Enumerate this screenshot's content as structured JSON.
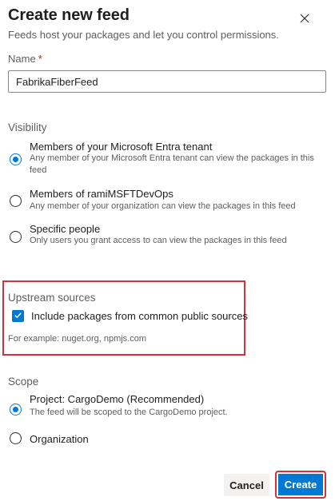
{
  "dialog": {
    "title": "Create new feed",
    "subtitle": "Feeds host your packages and let you control permissions.",
    "close_icon": "close-icon"
  },
  "name_field": {
    "label": "Name",
    "required_marker": "*",
    "value": "FabrikaFiberFeed"
  },
  "visibility": {
    "title": "Visibility",
    "options": [
      {
        "label": "Members of your Microsoft Entra tenant",
        "description_line1": "Any member of your Microsoft Entra tenant can view the packages in this",
        "description_line2": "feed",
        "selected": true
      },
      {
        "label": "Members of ramiMSFTDevOps",
        "description_line1": "Any member of your organization can view the packages in this feed",
        "selected": false
      },
      {
        "label": "Specific people",
        "description_line1": "Only users you grant access to can view the packages in this feed",
        "selected": false
      }
    ]
  },
  "upstream": {
    "title": "Upstream sources",
    "checkbox_label": "Include packages from common public sources",
    "checked": true,
    "example": "For example: nuget.org, npmjs.com",
    "highlight_color": "#d13438"
  },
  "scope": {
    "title": "Scope",
    "options": [
      {
        "label": "Project: CargoDemo (Recommended)",
        "description": "The feed will be scoped to the CargoDemo project.",
        "selected": true
      },
      {
        "label": "Organization",
        "selected": false
      }
    ]
  },
  "footer": {
    "cancel_label": "Cancel",
    "create_label": "Create"
  },
  "colors": {
    "accent": "#0078d4",
    "highlight": "#d13438"
  }
}
